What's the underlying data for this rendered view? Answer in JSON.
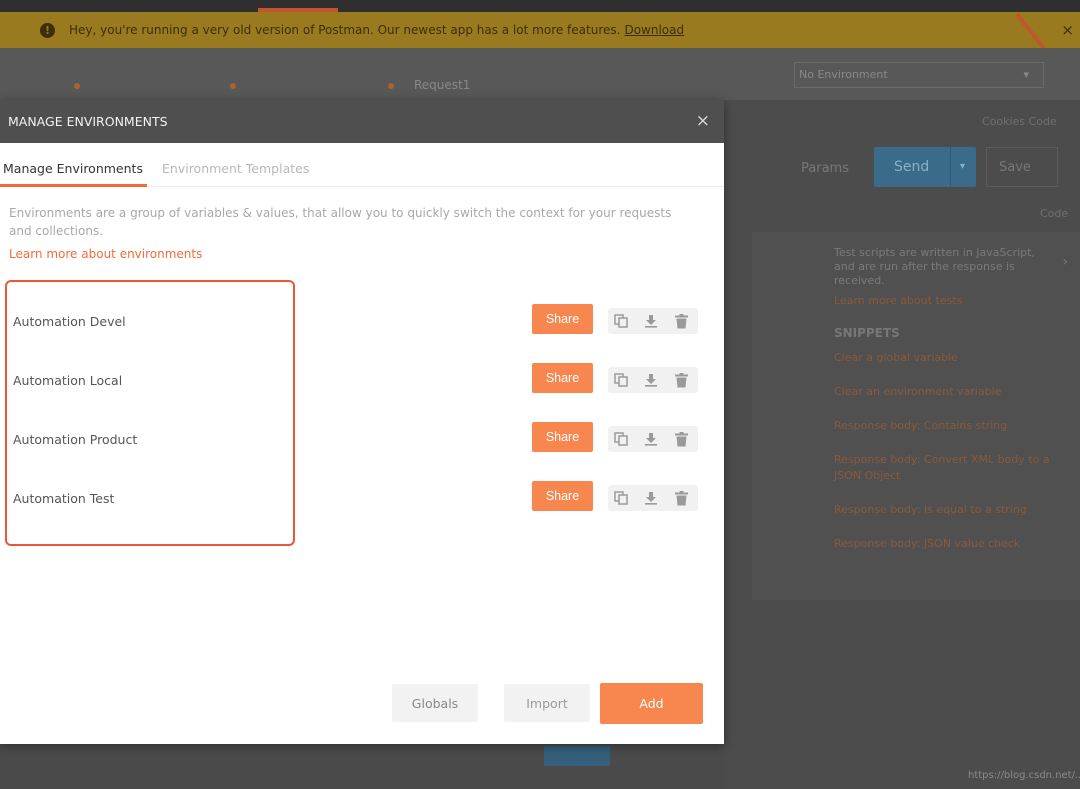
{
  "background": {
    "banner_text": "Hey, you're running a very old version of Postman. Our newest app has a lot more features.",
    "banner_link": "Download",
    "banner_close": "×",
    "tab_label": "Request1",
    "environment_select": "No Environment",
    "cookies_link": "Cookies  Code",
    "params_label": "Params",
    "send_label": "Send",
    "save_label": "Save",
    "code_link": "Code",
    "tests_description": "Test scripts are written in JavaScript, and are run after the response is received.",
    "tests_learn_more": "Learn more about tests",
    "snippets_heading": "SNIPPETS",
    "snippets": [
      "Clear a global variable",
      "Clear an environment variable",
      "Response body: Contains string",
      "Response body: Convert XML body to a JSON Object",
      "Response body: Is equal to a string",
      "Response body: JSON value check"
    ],
    "watermark": "https://blog.csdn.net/..."
  },
  "modal": {
    "title": "MANAGE ENVIRONMENTS",
    "close_label": "×",
    "tabs": [
      {
        "label": "Manage Environments"
      },
      {
        "label": "Environment Templates"
      }
    ],
    "description": "Environments are a group of variables & values, that allow you to quickly switch the context for your requests and collections.",
    "learn_more": "Learn more about environments",
    "environments": [
      {
        "name": "Automation Devel",
        "share_label": "Share"
      },
      {
        "name": "Automation Local",
        "share_label": "Share"
      },
      {
        "name": "Automation Product",
        "share_label": "Share"
      },
      {
        "name": "Automation Test",
        "share_label": "Share"
      }
    ],
    "footer": {
      "globals_label": "Globals",
      "import_label": "Import",
      "add_label": "Add"
    }
  },
  "colors": {
    "accent": "#f7874f",
    "highlight_border": "#e8573a",
    "header_bg": "#4f4f4f"
  }
}
